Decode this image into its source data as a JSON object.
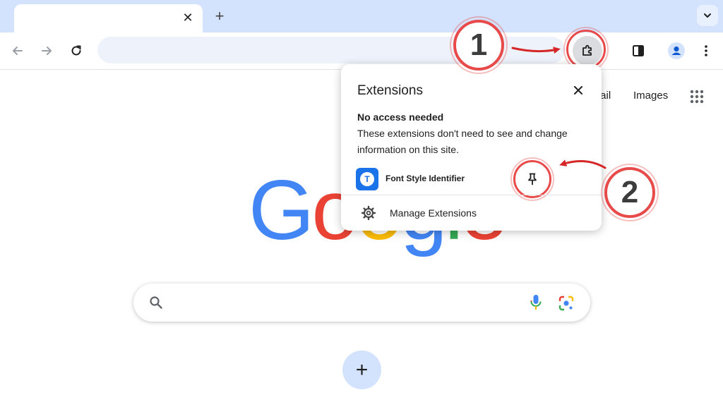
{
  "browser": {
    "tab": {
      "close_glyph": "✕"
    },
    "new_tab_glyph": "+"
  },
  "google": {
    "links": {
      "gmail": "Gmail",
      "images": "Images"
    },
    "logo": {
      "letters": [
        "G",
        "o",
        "o",
        "g",
        "l",
        "e"
      ],
      "colors": [
        "#4285f4",
        "#ea4335",
        "#fbbc05",
        "#4285f4",
        "#34a853",
        "#ea4335"
      ]
    },
    "add_shortcut_glyph": "+"
  },
  "popup": {
    "title": "Extensions",
    "heading": "No access needed",
    "description": "These extensions don't need to see and change information on this site.",
    "extension": {
      "name": "Font Style Identifier",
      "tile_letter": "T"
    },
    "manage_label": "Manage Extensions"
  },
  "annotations": {
    "callout_1": "1",
    "callout_2": "2",
    "color": "#e84a4a"
  }
}
